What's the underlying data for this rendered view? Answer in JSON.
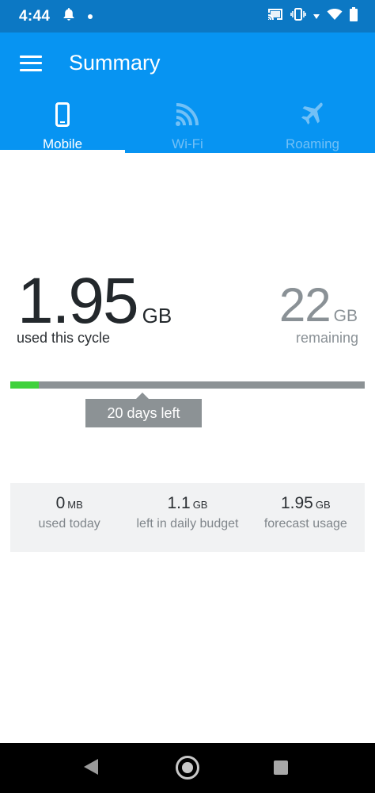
{
  "status_bar": {
    "time": "4:44",
    "icons": [
      "notification-bell-icon",
      "notification-dot-icon",
      "cast-icon",
      "vibrate-icon",
      "wifi-icon",
      "battery-icon"
    ]
  },
  "app_bar": {
    "title": "Summary",
    "menu_icon": "hamburger-menu-icon"
  },
  "tabs": [
    {
      "label": "Mobile",
      "icon": "phone-icon",
      "active": true
    },
    {
      "label": "Wi-Fi",
      "icon": "wifi-icon",
      "active": false
    },
    {
      "label": "Roaming",
      "icon": "airplane-icon",
      "active": false
    }
  ],
  "usage": {
    "used_value": "1.95",
    "used_unit": "GB",
    "used_label": "used this cycle",
    "remaining_value": "22",
    "remaining_unit": "GB",
    "remaining_label": "remaining",
    "progress_fraction": 0.08,
    "days_left": "20 days left"
  },
  "stats": [
    {
      "value": "0",
      "unit": "MB",
      "label": "used today"
    },
    {
      "value": "1.1",
      "unit": "GB",
      "label": "left in daily budget"
    },
    {
      "value": "1.95",
      "unit": "GB",
      "label": "forecast usage"
    }
  ],
  "colors": {
    "status_bar": "#0c78c4",
    "app_bar": "#0794f2",
    "progress_fill": "#3fd13c",
    "progress_track": "#8c9295"
  },
  "nav_bar": {
    "buttons": [
      "back-icon",
      "home-icon",
      "recents-icon"
    ]
  }
}
